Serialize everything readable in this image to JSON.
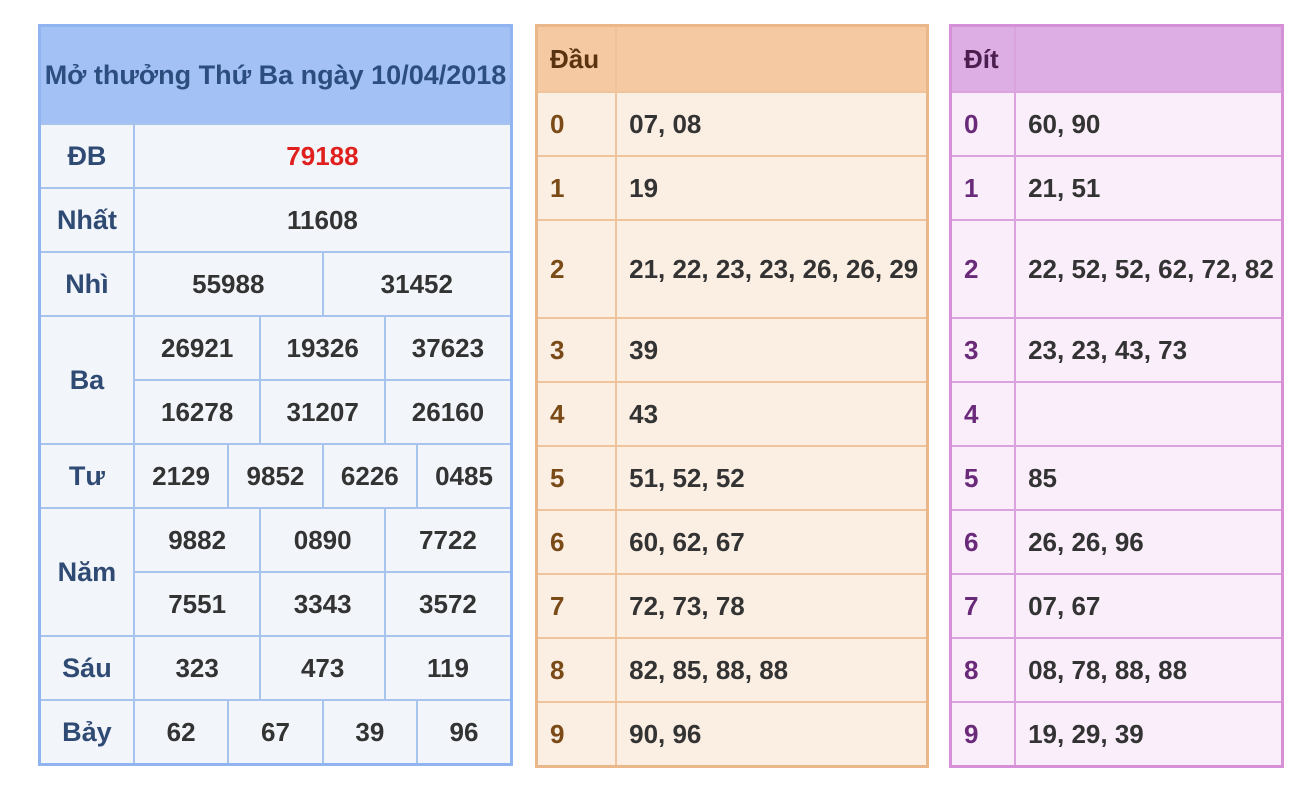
{
  "results": {
    "title": "Mở thưởng Thứ Ba ngày 10/04/2018",
    "rows": {
      "db": {
        "label": "ĐB",
        "values": [
          "79188"
        ]
      },
      "nhat": {
        "label": "Nhất",
        "values": [
          "11608"
        ]
      },
      "nhi": {
        "label": "Nhì",
        "values": [
          "55988",
          "31452"
        ]
      },
      "ba": {
        "label": "Ba",
        "values": [
          "26921",
          "19326",
          "37623",
          "16278",
          "31207",
          "26160"
        ]
      },
      "tu": {
        "label": "Tư",
        "values": [
          "2129",
          "9852",
          "6226",
          "0485"
        ]
      },
      "nam": {
        "label": "Năm",
        "values": [
          "9882",
          "0890",
          "7722",
          "7551",
          "3343",
          "3572"
        ]
      },
      "sau": {
        "label": "Sáu",
        "values": [
          "323",
          "473",
          "119"
        ]
      },
      "bay": {
        "label": "Bảy",
        "values": [
          "62",
          "67",
          "39",
          "96"
        ]
      }
    },
    "special_color": "#e0201e"
  },
  "dau": {
    "header": "Đầu",
    "header_value": "",
    "rows": [
      {
        "key": "0",
        "value": "07, 08"
      },
      {
        "key": "1",
        "value": "19"
      },
      {
        "key": "2",
        "value": "21, 22, 23, 23, 26, 26, 29"
      },
      {
        "key": "3",
        "value": "39"
      },
      {
        "key": "4",
        "value": "43"
      },
      {
        "key": "5",
        "value": "51, 52, 52"
      },
      {
        "key": "6",
        "value": "60, 62, 67"
      },
      {
        "key": "7",
        "value": "72, 73, 78"
      },
      {
        "key": "8",
        "value": "82, 85, 88, 88"
      },
      {
        "key": "9",
        "value": "90, 96"
      }
    ]
  },
  "dit": {
    "header": "Đít",
    "header_value": "",
    "rows": [
      {
        "key": "0",
        "value": "60, 90"
      },
      {
        "key": "1",
        "value": "21, 51"
      },
      {
        "key": "2",
        "value": "22, 52, 52, 62, 72, 82"
      },
      {
        "key": "3",
        "value": "23, 23, 43, 73"
      },
      {
        "key": "4",
        "value": ""
      },
      {
        "key": "5",
        "value": "85"
      },
      {
        "key": "6",
        "value": "26, 26, 96"
      },
      {
        "key": "7",
        "value": "07, 67"
      },
      {
        "key": "8",
        "value": "08, 78, 88, 88"
      },
      {
        "key": "9",
        "value": "19, 29, 39"
      }
    ]
  }
}
